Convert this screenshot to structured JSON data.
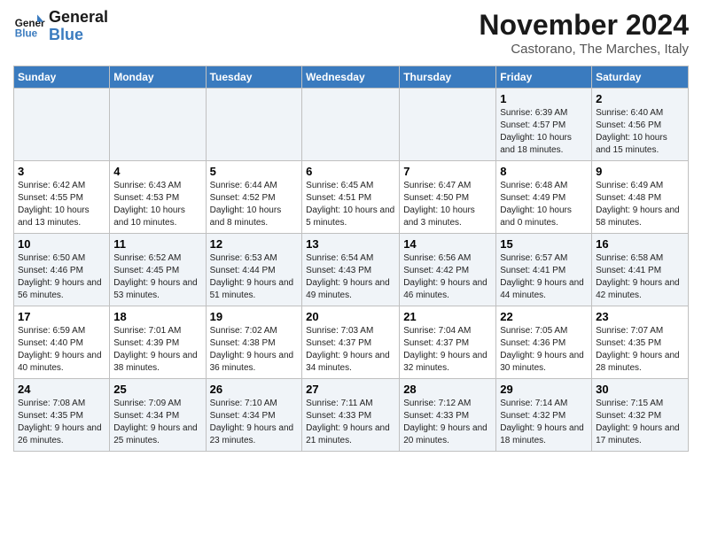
{
  "logo": {
    "line1": "General",
    "line2": "Blue"
  },
  "title": "November 2024",
  "subtitle": "Castorano, The Marches, Italy",
  "weekdays": [
    "Sunday",
    "Monday",
    "Tuesday",
    "Wednesday",
    "Thursday",
    "Friday",
    "Saturday"
  ],
  "weeks": [
    [
      {
        "day": "",
        "info": ""
      },
      {
        "day": "",
        "info": ""
      },
      {
        "day": "",
        "info": ""
      },
      {
        "day": "",
        "info": ""
      },
      {
        "day": "",
        "info": ""
      },
      {
        "day": "1",
        "info": "Sunrise: 6:39 AM\nSunset: 4:57 PM\nDaylight: 10 hours and 18 minutes."
      },
      {
        "day": "2",
        "info": "Sunrise: 6:40 AM\nSunset: 4:56 PM\nDaylight: 10 hours and 15 minutes."
      }
    ],
    [
      {
        "day": "3",
        "info": "Sunrise: 6:42 AM\nSunset: 4:55 PM\nDaylight: 10 hours and 13 minutes."
      },
      {
        "day": "4",
        "info": "Sunrise: 6:43 AM\nSunset: 4:53 PM\nDaylight: 10 hours and 10 minutes."
      },
      {
        "day": "5",
        "info": "Sunrise: 6:44 AM\nSunset: 4:52 PM\nDaylight: 10 hours and 8 minutes."
      },
      {
        "day": "6",
        "info": "Sunrise: 6:45 AM\nSunset: 4:51 PM\nDaylight: 10 hours and 5 minutes."
      },
      {
        "day": "7",
        "info": "Sunrise: 6:47 AM\nSunset: 4:50 PM\nDaylight: 10 hours and 3 minutes."
      },
      {
        "day": "8",
        "info": "Sunrise: 6:48 AM\nSunset: 4:49 PM\nDaylight: 10 hours and 0 minutes."
      },
      {
        "day": "9",
        "info": "Sunrise: 6:49 AM\nSunset: 4:48 PM\nDaylight: 9 hours and 58 minutes."
      }
    ],
    [
      {
        "day": "10",
        "info": "Sunrise: 6:50 AM\nSunset: 4:46 PM\nDaylight: 9 hours and 56 minutes."
      },
      {
        "day": "11",
        "info": "Sunrise: 6:52 AM\nSunset: 4:45 PM\nDaylight: 9 hours and 53 minutes."
      },
      {
        "day": "12",
        "info": "Sunrise: 6:53 AM\nSunset: 4:44 PM\nDaylight: 9 hours and 51 minutes."
      },
      {
        "day": "13",
        "info": "Sunrise: 6:54 AM\nSunset: 4:43 PM\nDaylight: 9 hours and 49 minutes."
      },
      {
        "day": "14",
        "info": "Sunrise: 6:56 AM\nSunset: 4:42 PM\nDaylight: 9 hours and 46 minutes."
      },
      {
        "day": "15",
        "info": "Sunrise: 6:57 AM\nSunset: 4:41 PM\nDaylight: 9 hours and 44 minutes."
      },
      {
        "day": "16",
        "info": "Sunrise: 6:58 AM\nSunset: 4:41 PM\nDaylight: 9 hours and 42 minutes."
      }
    ],
    [
      {
        "day": "17",
        "info": "Sunrise: 6:59 AM\nSunset: 4:40 PM\nDaylight: 9 hours and 40 minutes."
      },
      {
        "day": "18",
        "info": "Sunrise: 7:01 AM\nSunset: 4:39 PM\nDaylight: 9 hours and 38 minutes."
      },
      {
        "day": "19",
        "info": "Sunrise: 7:02 AM\nSunset: 4:38 PM\nDaylight: 9 hours and 36 minutes."
      },
      {
        "day": "20",
        "info": "Sunrise: 7:03 AM\nSunset: 4:37 PM\nDaylight: 9 hours and 34 minutes."
      },
      {
        "day": "21",
        "info": "Sunrise: 7:04 AM\nSunset: 4:37 PM\nDaylight: 9 hours and 32 minutes."
      },
      {
        "day": "22",
        "info": "Sunrise: 7:05 AM\nSunset: 4:36 PM\nDaylight: 9 hours and 30 minutes."
      },
      {
        "day": "23",
        "info": "Sunrise: 7:07 AM\nSunset: 4:35 PM\nDaylight: 9 hours and 28 minutes."
      }
    ],
    [
      {
        "day": "24",
        "info": "Sunrise: 7:08 AM\nSunset: 4:35 PM\nDaylight: 9 hours and 26 minutes."
      },
      {
        "day": "25",
        "info": "Sunrise: 7:09 AM\nSunset: 4:34 PM\nDaylight: 9 hours and 25 minutes."
      },
      {
        "day": "26",
        "info": "Sunrise: 7:10 AM\nSunset: 4:34 PM\nDaylight: 9 hours and 23 minutes."
      },
      {
        "day": "27",
        "info": "Sunrise: 7:11 AM\nSunset: 4:33 PM\nDaylight: 9 hours and 21 minutes."
      },
      {
        "day": "28",
        "info": "Sunrise: 7:12 AM\nSunset: 4:33 PM\nDaylight: 9 hours and 20 minutes."
      },
      {
        "day": "29",
        "info": "Sunrise: 7:14 AM\nSunset: 4:32 PM\nDaylight: 9 hours and 18 minutes."
      },
      {
        "day": "30",
        "info": "Sunrise: 7:15 AM\nSunset: 4:32 PM\nDaylight: 9 hours and 17 minutes."
      }
    ]
  ]
}
